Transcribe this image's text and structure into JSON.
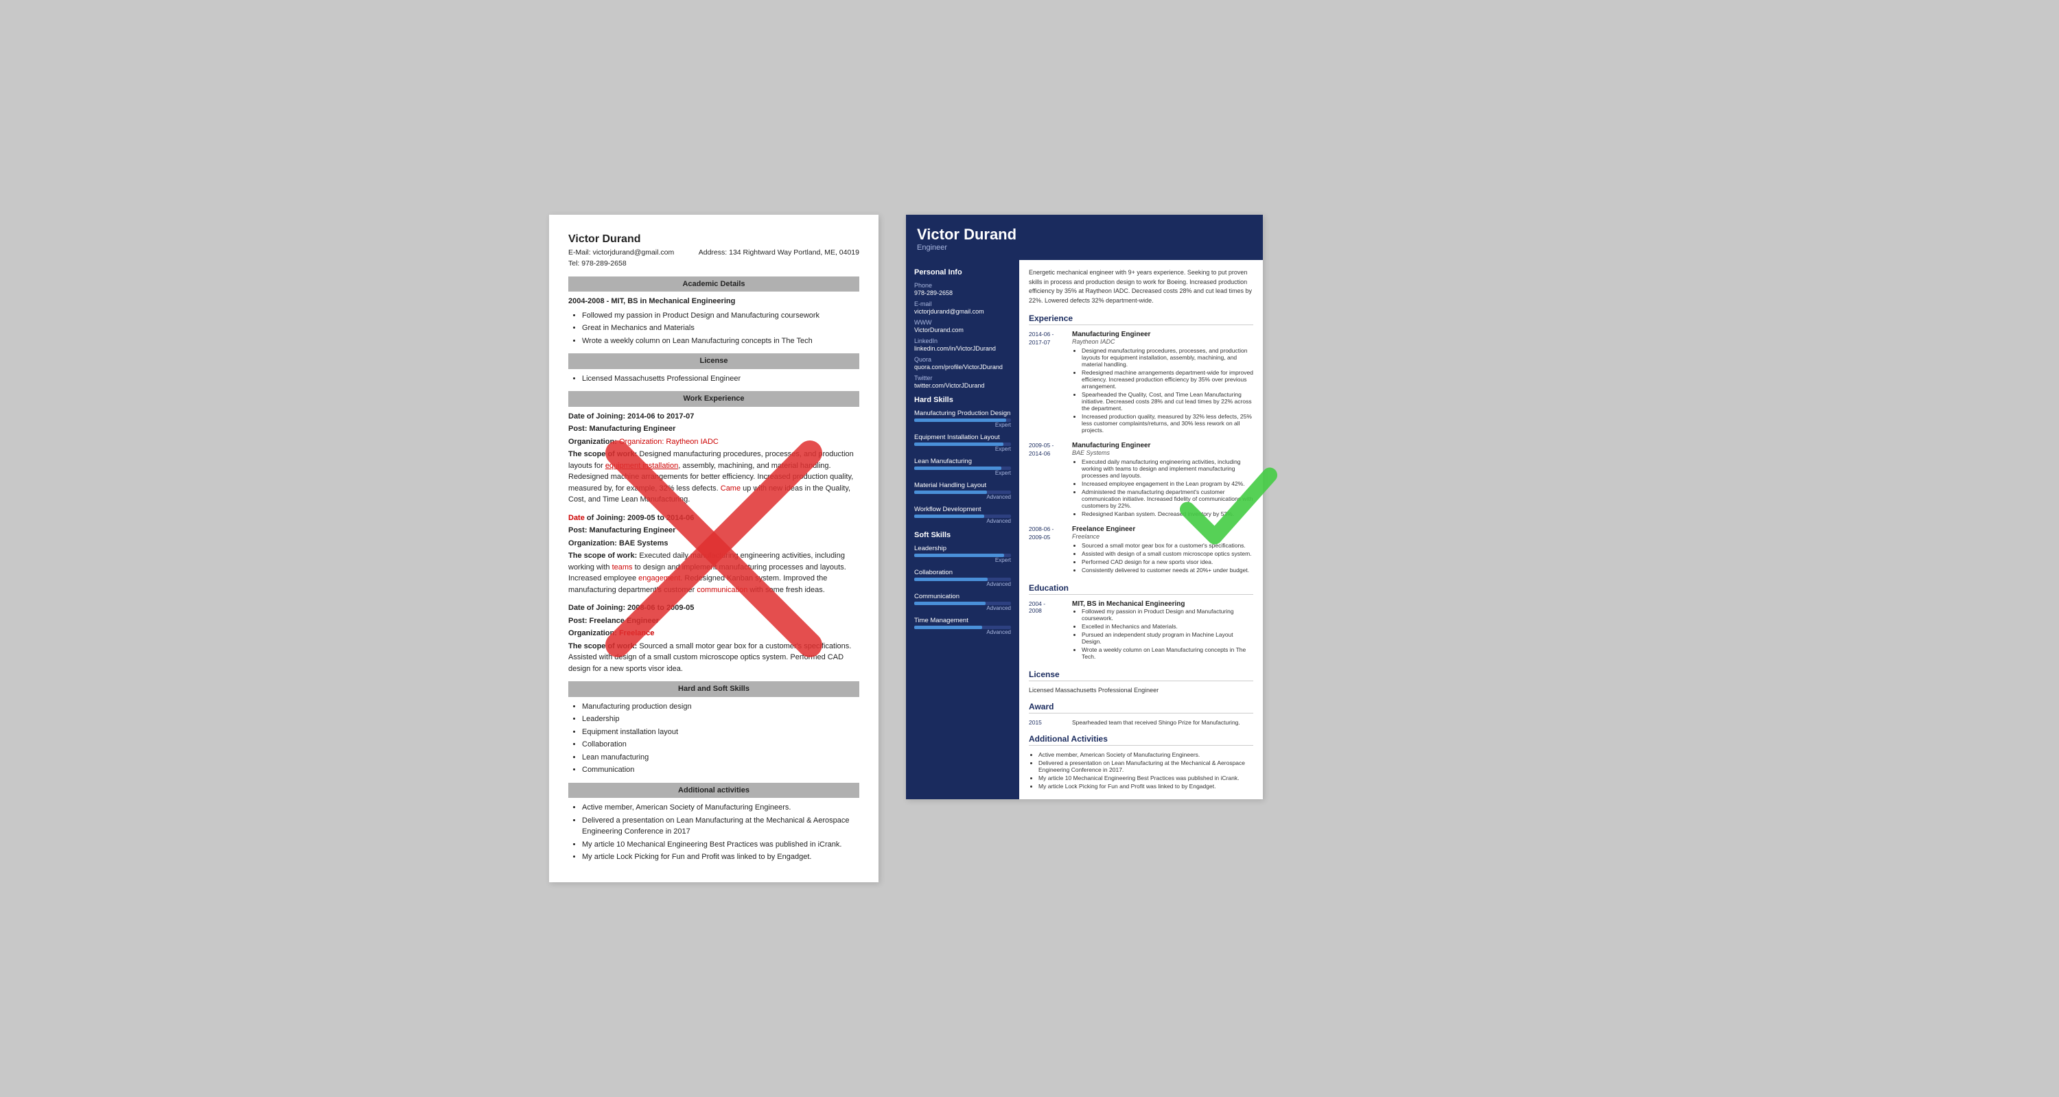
{
  "left": {
    "name": "Victor Durand",
    "email_label": "E-Mail:",
    "email": "victorjdurand@gmail.com",
    "address_label": "Address:",
    "address": "134 Rightward Way Portland, ME, 04019",
    "tel_label": "Tel:",
    "tel": "978-289-2658",
    "academic_section": "Academic Details",
    "academic_date": "2004-2008 -",
    "academic_degree": "MIT, BS in Mechanical Engineering",
    "academic_bullets": [
      "Followed my passion in Product Design and Manufacturing coursework",
      "Great in Mechanics and Materials",
      "Wrote a weekly column on Lean Manufacturing concepts in The Tech"
    ],
    "license_section": "License",
    "license_bullets": [
      "Licensed Massachusetts Professional Engineer"
    ],
    "work_section": "Work Experience",
    "jobs": [
      {
        "date": "Date of Joining: 2014-06 to 2017-07",
        "post": "Post: Manufacturing Engineer",
        "org": "Organization: Raytheon IADC",
        "scope_label": "The scope of work:",
        "scope": "Designed manufacturing procedures, processes, and production layouts for equipment installation, assembly, machining, and material handling. Redesigned machine arrangements for better efficiency. Increased production quality, measured by, for example, 32% less defects. Came up with new ideas in the Quality, Cost, and Time Lean Manufacturing."
      },
      {
        "date": "Date of Joining: 2009-05 to 2014-06",
        "post": "Post: Manufacturing Engineer",
        "org": "Organization: BAE Systems",
        "scope_label": "The scope of work:",
        "scope": "Executed daily manufacturing engineering activities, including working with teams to design and implement manufacturing processes and layouts. Increased employee engagement. Redesigned Kanban system. Improved the manufacturing department's customer communication with some fresh ideas."
      },
      {
        "date": "Date of Joining: 2008-06 to 2009-05",
        "post": "Post: Freelance Engineer",
        "org": "Organization: Freelance",
        "scope_label": "The scope of work:",
        "scope": "Sourced a small motor gear box for a customer's specifications. Assisted with design of a small custom microscope optics system. Performed CAD design for a new sports visor idea."
      }
    ],
    "skills_section": "Hard and Soft Skills",
    "skills": [
      "Manufacturing production design",
      "Leadership",
      "Equipment installation layout",
      "Collaboration",
      "Lean manufacturing",
      "Communication"
    ],
    "activities_section": "Additional activities",
    "activities": [
      "Active member, American Society of Manufacturing Engineers.",
      "Delivered a presentation on Lean Manufacturing at the Mechanical & Aerospace Engineering Conference in 2017",
      "My article 10 Mechanical Engineering Best Practices was published in iCrank.",
      "My article Lock Picking for Fun and Profit was linked to by Engadget."
    ]
  },
  "right": {
    "name": "Victor Durand",
    "title": "Engineer",
    "summary": "Energetic mechanical engineer with 9+ years experience. Seeking to put proven skills in process and production design to work for Boeing. Increased production efficiency by 35% at Raytheon IADC. Decreased costs 28% and cut lead times by 22%. Lowered defects 32% department-wide.",
    "personal_info_title": "Personal Info",
    "fields": [
      {
        "label": "Phone",
        "value": "978-289-2658"
      },
      {
        "label": "E-mail",
        "value": "victorjdurand@gmail.com"
      },
      {
        "label": "WWW",
        "value": "VictorDurand.com"
      },
      {
        "label": "LinkedIn",
        "value": "linkedin.com/in/VictorJDurand"
      },
      {
        "label": "Quora",
        "value": "quora.com/profile/VictorJDurand"
      },
      {
        "label": "Twitter",
        "value": "twitter.com/VictorJDurand"
      }
    ],
    "hard_skills_title": "Hard Skills",
    "hard_skills": [
      {
        "name": "Manufacturing Production Design",
        "level": "Expert",
        "pct": 95
      },
      {
        "name": "Equipment Installation Layout",
        "level": "Expert",
        "pct": 92
      },
      {
        "name": "Lean Manufacturing",
        "level": "Expert",
        "pct": 90
      },
      {
        "name": "Material Handling Layout",
        "level": "Advanced",
        "pct": 75
      },
      {
        "name": "Workflow Development",
        "level": "Advanced",
        "pct": 72
      }
    ],
    "soft_skills_title": "Soft Skills",
    "soft_skills": [
      {
        "name": "Leadership",
        "level": "Expert",
        "pct": 93
      },
      {
        "name": "Collaboration",
        "level": "Advanced",
        "pct": 76
      },
      {
        "name": "Communication",
        "level": "Advanced",
        "pct": 74
      },
      {
        "name": "Time Management",
        "level": "Advanced",
        "pct": 70
      }
    ],
    "experience_title": "Experience",
    "jobs": [
      {
        "date": "2014-06 -\n2017-07",
        "title": "Manufacturing Engineer",
        "org": "Raytheon IADC",
        "bullets": [
          "Designed manufacturing procedures, processes, and production layouts for equipment installation, assembly, machining, and material handling.",
          "Redesigned machine arrangements department-wide for improved efficiency. Increased production efficiency by 35% over previous arrangement.",
          "Spearheaded the Quality, Cost, and Time Lean Manufacturing initiative. Decreased costs 28% and cut lead times by 22% across the department.",
          "Increased production quality, measured by 32% less defects, 25% less customer complaints/returns, and 30% less rework on all projects."
        ]
      },
      {
        "date": "2009-05 -\n2014-06",
        "title": "Manufacturing Engineer",
        "org": "BAE Systems",
        "bullets": [
          "Executed daily manufacturing engineering activities, including working with teams to design and implement manufacturing processes and layouts.",
          "Increased employee engagement in the Lean program by 42%.",
          "Administered the manufacturing department's customer communication initiative. Increased fidelity of communications with customers by 22%.",
          "Redesigned Kanban system. Decreased inventory by 53%."
        ]
      },
      {
        "date": "2008-06 -\n2009-05",
        "title": "Freelance Engineer",
        "org": "Freelance",
        "bullets": [
          "Sourced a small motor gear box for a customer's specifications.",
          "Assisted with design of a small custom microscope optics system.",
          "Performed CAD design for a new sports visor idea.",
          "Consistently delivered to customer needs at 20%+ under budget."
        ]
      }
    ],
    "education_title": "Education",
    "education": [
      {
        "date": "2004 -\n2008",
        "degree": "MIT, BS in Mechanical Engineering",
        "bullets": [
          "Followed my passion in Product Design and Manufacturing coursework.",
          "Excelled in Mechanics and Materials.",
          "Pursued an independent study program in Machine Layout Design.",
          "Wrote a weekly column on Lean Manufacturing concepts in The Tech."
        ]
      }
    ],
    "license_title": "License",
    "license_text": "Licensed Massachusetts Professional Engineer",
    "award_title": "Award",
    "award_year": "2015",
    "award_text": "Spearheaded team that received Shingo Prize for Manufacturing.",
    "additional_title": "Additional Activities",
    "additional": [
      "Active member, American Society of Manufacturing Engineers.",
      "Delivered a presentation on Lean Manufacturing at the Mechanical & Aerospace Engineering Conference in 2017.",
      "My article 10 Mechanical Engineering Best Practices was published in iCrank.",
      "My article Lock Picking for Fun and Profit was linked to by Engadget."
    ]
  }
}
